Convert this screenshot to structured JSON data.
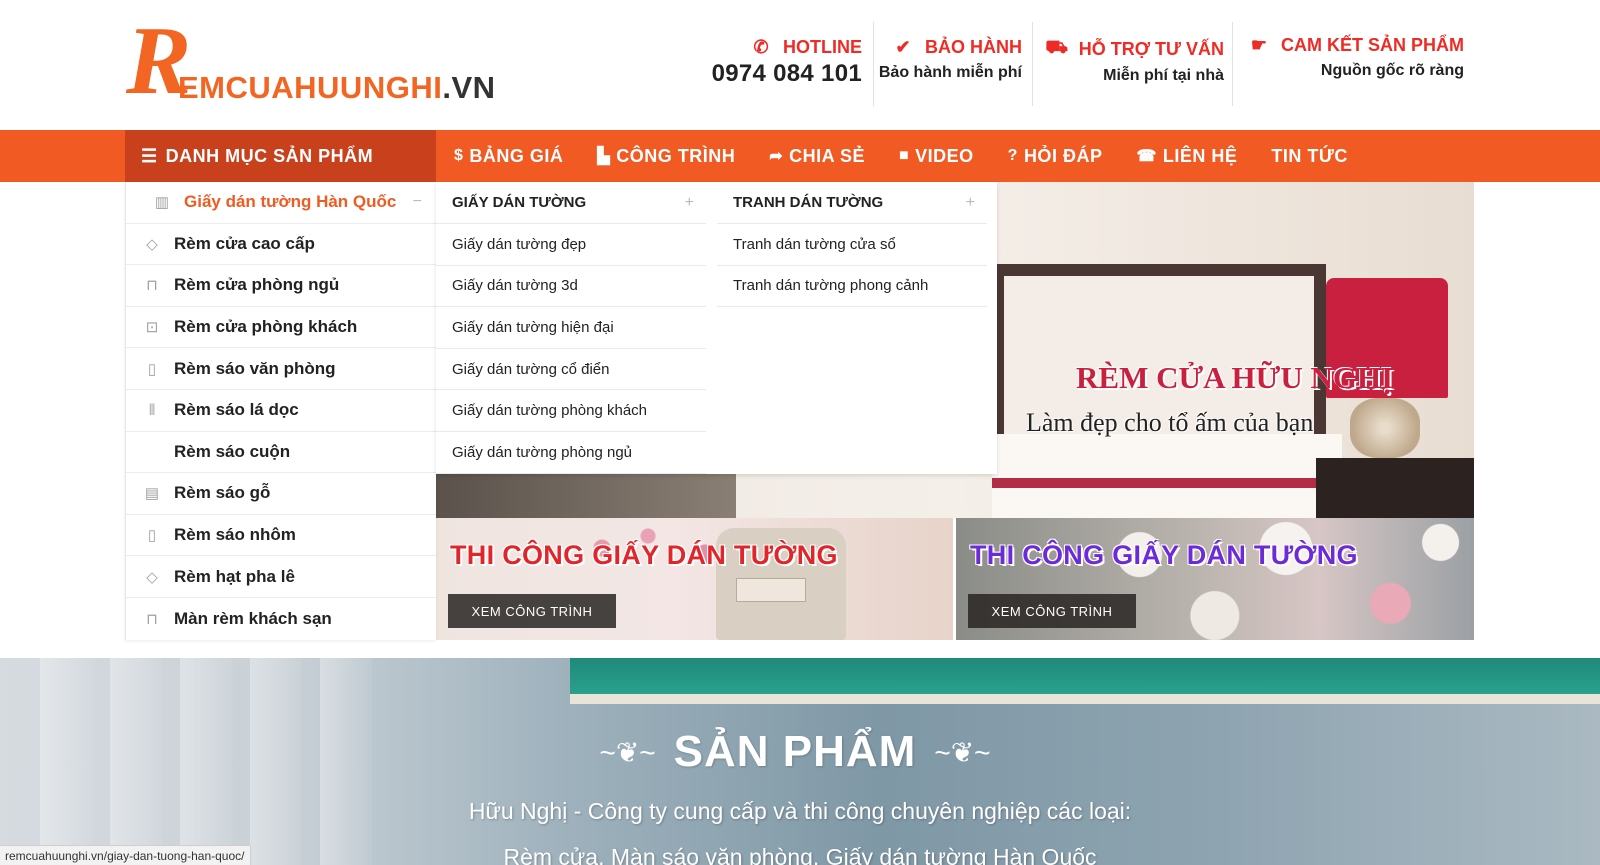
{
  "logo": {
    "initial": "R",
    "text": "EMCUAHUUNGHI",
    "tld": ".VN"
  },
  "header_info": [
    {
      "icon": "phone-icon",
      "glyph": "✆",
      "title": "HOTLINE",
      "sub": "0974 084 101"
    },
    {
      "icon": "badge-check-icon",
      "glyph": "✔",
      "title": "BẢO HÀNH",
      "sub": "Bảo hành miễn phí"
    },
    {
      "icon": "truck-icon",
      "glyph": "⛟",
      "title": "HỖ TRỢ TƯ VẤN",
      "sub": "Miễn phí tại nhà"
    },
    {
      "icon": "handshake-icon",
      "glyph": "☛",
      "title": "CAM KẾT SẢN PHẨM",
      "sub": "Nguồn gốc rõ ràng"
    }
  ],
  "nav": {
    "category_label": "DANH MỤC SẢN PHẨM",
    "items": [
      {
        "icon": "dollar-icon",
        "glyph": "$",
        "label": "BẢNG GIÁ"
      },
      {
        "icon": "chart-icon",
        "glyph": "▙",
        "label": "CÔNG TRÌNH"
      },
      {
        "icon": "share-icon",
        "glyph": "➦",
        "label": "CHIA SẺ"
      },
      {
        "icon": "video-icon",
        "glyph": "■",
        "label": "VIDEO"
      },
      {
        "icon": "question-icon",
        "glyph": "?",
        "label": "HỎI ĐÁP"
      },
      {
        "icon": "contact-icon",
        "glyph": "☎",
        "label": "LIÊN HỆ"
      },
      {
        "icon": "",
        "glyph": "",
        "label": "TIN TỨC"
      }
    ]
  },
  "side_menu": [
    {
      "icon": "wallpaper-icon",
      "glyph": "▥",
      "label": "Giấy dán tường Hàn Quốc",
      "active": true
    },
    {
      "icon": "diamond-icon",
      "glyph": "◇",
      "label": "Rèm cửa cao cấp"
    },
    {
      "icon": "curtain-icon",
      "glyph": "⊓",
      "label": "Rèm cửa phòng ngủ"
    },
    {
      "icon": "curtain-icon",
      "glyph": "⊡",
      "label": "Rèm cửa phòng khách"
    },
    {
      "icon": "blind-icon",
      "glyph": "▯",
      "label": "Rèm sáo văn phòng"
    },
    {
      "icon": "vertical-blind-icon",
      "glyph": "⦀",
      "label": "Rèm sáo lá dọc"
    },
    {
      "icon": "",
      "glyph": "",
      "label": "Rèm sáo cuộn"
    },
    {
      "icon": "wood-blind-icon",
      "glyph": "▤",
      "label": "Rèm sáo gỗ"
    },
    {
      "icon": "aluminium-blind-icon",
      "glyph": "▯",
      "label": "Rèm sáo nhôm"
    },
    {
      "icon": "crystal-icon",
      "glyph": "◇",
      "label": "Rèm hạt pha lê"
    },
    {
      "icon": "hotel-curtain-icon",
      "glyph": "⊓",
      "label": "Màn rèm khách sạn"
    }
  ],
  "mega": {
    "col1": {
      "heading": "GIẤY DÁN TƯỜNG",
      "links": [
        "Giấy dán tường đẹp",
        "Giấy dán tường 3d",
        "Giấy dán tường hiện đại",
        "Giấy dán tường cổ điển",
        "Giấy dán tường phòng khách",
        "Giấy dán tường phòng ngủ"
      ]
    },
    "col2": {
      "heading": "TRANH DÁN TƯỜNG",
      "links": [
        "Tranh dán tường cửa sổ",
        "Tranh dán tường phong cảnh"
      ]
    }
  },
  "hero": {
    "title": "RÈM CỬA HỮU NGHỊ",
    "subtitle": "Làm đẹp cho tổ ấm của bạn"
  },
  "promos": [
    {
      "title": "THI CÔNG GIẤY DÁN TƯỜNG",
      "button": "XEM CÔNG TRÌNH"
    },
    {
      "title": "THI CÔNG GIẤY DÁN TƯỜNG",
      "button": "XEM CÔNG TRÌNH"
    }
  ],
  "products": {
    "title": "SẢN PHẨM",
    "description": "Hữu Nghị - Công ty cung cấp và thi công chuyên nghiệp các loại:",
    "description2": "Rèm cửa, Màn sáo văn phòng, Giấy dán tường Hàn Quốc"
  },
  "status_url": "remcuahuunghi.vn/giay-dan-tuong-han-quoc/",
  "colors": {
    "brand_orange": "#f15a22",
    "nav_dark": "#c9411c",
    "hotline_red": "#ee2b24"
  }
}
